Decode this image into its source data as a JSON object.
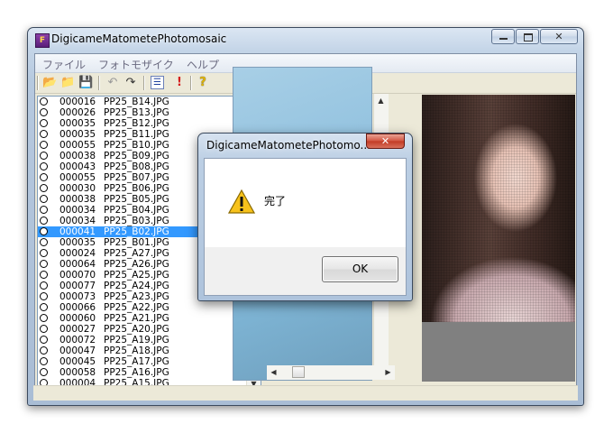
{
  "window": {
    "title": "DigicameMatometePhotomosaic",
    "app_icon": "F"
  },
  "menu": [
    "ファイル",
    "フォトモザイク",
    "ヘルプ"
  ],
  "toolbar": {
    "open": "📂",
    "new": "📁",
    "save": "💾",
    "undo": "↶",
    "redo": "↷",
    "list": "☰",
    "alert": "!",
    "help": "?"
  },
  "file_list": [
    {
      "num": "000016",
      "file": "PP25_B14.JPG"
    },
    {
      "num": "000026",
      "file": "PP25_B13.JPG"
    },
    {
      "num": "000035",
      "file": "PP25_B12.JPG"
    },
    {
      "num": "000035",
      "file": "PP25_B11.JPG"
    },
    {
      "num": "000055",
      "file": "PP25_B10.JPG"
    },
    {
      "num": "000038",
      "file": "PP25_B09.JPG"
    },
    {
      "num": "000043",
      "file": "PP25_B08.JPG"
    },
    {
      "num": "000055",
      "file": "PP25_B07.JPG"
    },
    {
      "num": "000030",
      "file": "PP25_B06.JPG"
    },
    {
      "num": "000038",
      "file": "PP25_B05.JPG"
    },
    {
      "num": "000034",
      "file": "PP25_B04.JPG"
    },
    {
      "num": "000034",
      "file": "PP25_B03.JPG"
    },
    {
      "num": "000041",
      "file": "PP25_B02.JPG",
      "selected": true
    },
    {
      "num": "000035",
      "file": "PP25_B01.JPG"
    },
    {
      "num": "000024",
      "file": "PP25_A27.JPG"
    },
    {
      "num": "000064",
      "file": "PP25_A26.JPG"
    },
    {
      "num": "000070",
      "file": "PP25_A25.JPG"
    },
    {
      "num": "000077",
      "file": "PP25_A24.JPG"
    },
    {
      "num": "000073",
      "file": "PP25_A23.JPG"
    },
    {
      "num": "000066",
      "file": "PP25_A22.JPG"
    },
    {
      "num": "000060",
      "file": "PP25_A21.JPG"
    },
    {
      "num": "000027",
      "file": "PP25_A20.JPG"
    },
    {
      "num": "000072",
      "file": "PP25_A19.JPG"
    },
    {
      "num": "000047",
      "file": "PP25_A18.JPG"
    },
    {
      "num": "000045",
      "file": "PP25_A17.JPG"
    },
    {
      "num": "000058",
      "file": "PP25_A16.JPG"
    },
    {
      "num": "000004",
      "file": "PP25_A15.JPG"
    }
  ],
  "dialog": {
    "title": "DigicameMatometePhotomo...",
    "message": "完了",
    "ok_label": "OK",
    "icon": "warning-icon"
  },
  "colors": {
    "selection": "#3399ff",
    "close_button": "#c13a24"
  }
}
